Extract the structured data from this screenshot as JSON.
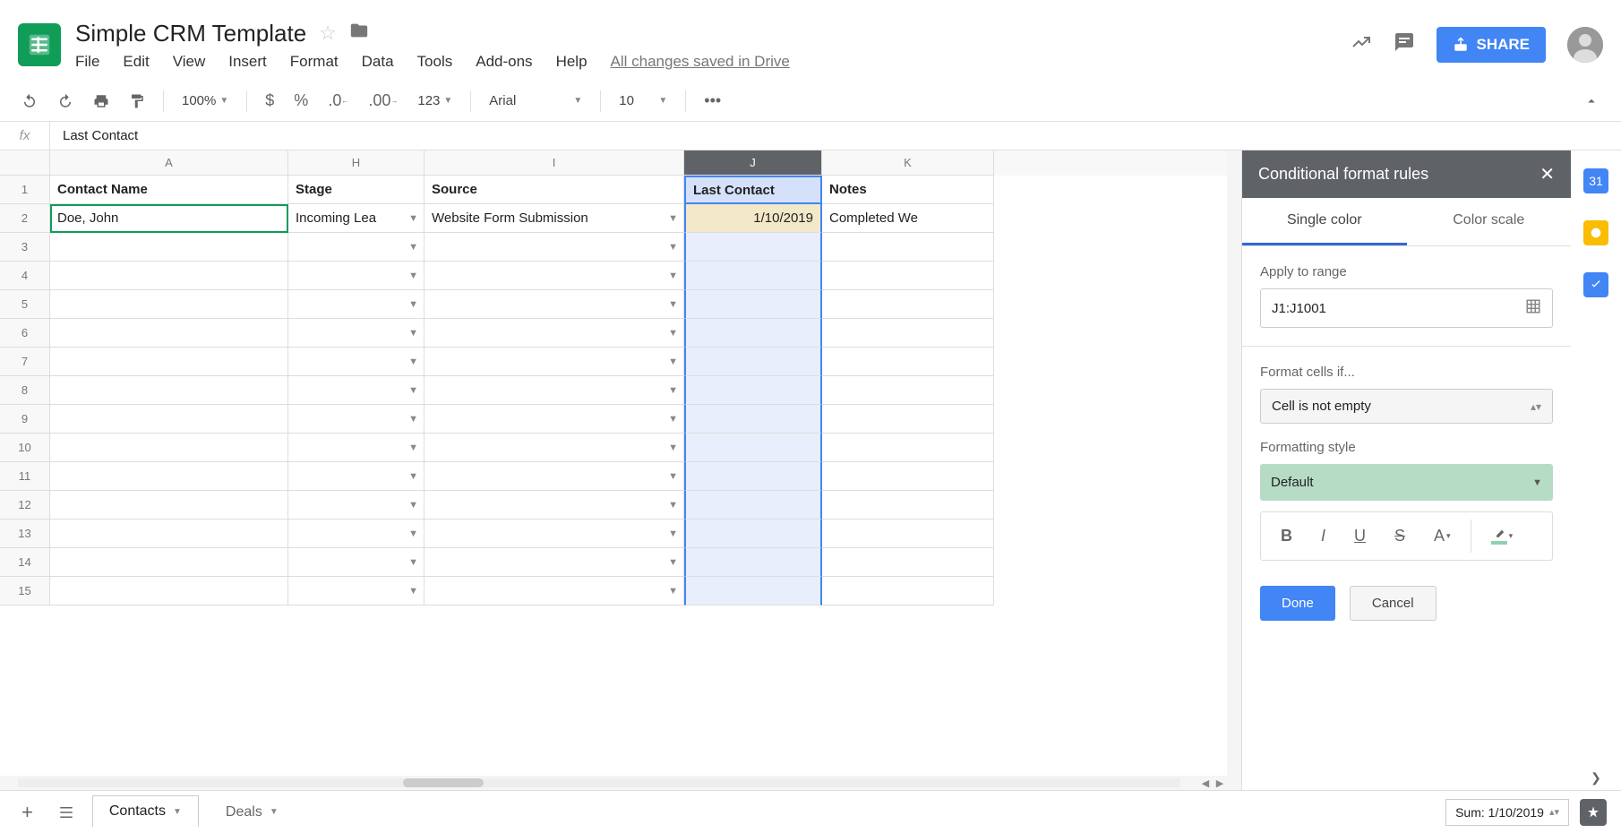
{
  "doc_title": "Simple CRM Template",
  "menus": [
    "File",
    "Edit",
    "View",
    "Insert",
    "Format",
    "Data",
    "Tools",
    "Add-ons",
    "Help"
  ],
  "saved_text": "All changes saved in Drive",
  "share_label": "SHARE",
  "toolbar": {
    "zoom": "100%",
    "font": "Arial",
    "size": "10",
    "number_format": "123"
  },
  "formula_bar": {
    "fx": "fx",
    "value": "Last Contact"
  },
  "columns": [
    {
      "letter": "A",
      "width": "col-A",
      "header": "Contact Name"
    },
    {
      "letter": "H",
      "width": "col-H",
      "header": "Stage"
    },
    {
      "letter": "I",
      "width": "col-I",
      "header": "Source"
    },
    {
      "letter": "J",
      "width": "col-J",
      "header": "Last Contact",
      "selected": true
    },
    {
      "letter": "K",
      "width": "col-K",
      "header": "Notes"
    }
  ],
  "data_row": {
    "A": "Doe, John",
    "H": "Incoming Lea",
    "I": "Website Form Submission",
    "J": "1/10/2019",
    "K": "Completed We"
  },
  "row_count": 15,
  "sidebar": {
    "title": "Conditional format rules",
    "tabs": [
      "Single color",
      "Color scale"
    ],
    "apply_label": "Apply to range",
    "range": "J1:J1001",
    "format_if_label": "Format cells if...",
    "condition": "Cell is not empty",
    "style_label": "Formatting style",
    "style_value": "Default",
    "done": "Done",
    "cancel": "Cancel"
  },
  "sheets": [
    "Contacts",
    "Deals"
  ],
  "sum_text": "Sum: 1/10/2019",
  "rail_calendar": "31"
}
